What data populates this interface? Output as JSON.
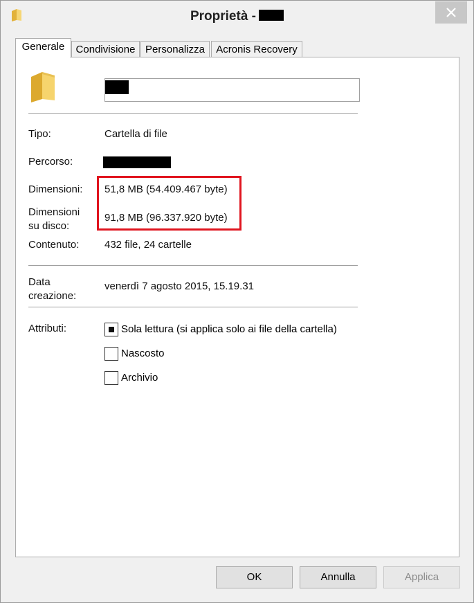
{
  "window": {
    "title": "Proprietà -"
  },
  "tabs": [
    {
      "label": "Generale"
    },
    {
      "label": "Condivisione"
    },
    {
      "label": "Personalizza"
    },
    {
      "label": "Acronis Recovery"
    }
  ],
  "general": {
    "type_label": "Tipo:",
    "type_value": "Cartella di file",
    "path_label": "Percorso:",
    "size_label": "Dimensioni:",
    "size_value": "51,8 MB (54.409.467 byte)",
    "disk_size_label_line1": "Dimensioni",
    "disk_size_label_line2": "su disco:",
    "disk_size_value": "91,8 MB (96.337.920 byte)",
    "contents_label": "Contenuto:",
    "contents_value": "432 file, 24 cartelle",
    "created_label_line1": "Data",
    "created_label_line2": "creazione:",
    "created_value": "venerdì 7 agosto 2015, 15.19.31",
    "attributes_label": "Attributi:",
    "attributes": [
      {
        "label": "Sola lettura (si applica solo ai file della cartella)",
        "state": "indeterminate"
      },
      {
        "label": "Nascosto",
        "state": "unchecked"
      },
      {
        "label": "Archivio",
        "state": "unchecked"
      }
    ]
  },
  "buttons": {
    "ok": "OK",
    "cancel": "Annulla",
    "apply": "Applica"
  },
  "colors": {
    "highlight": "#e0141e",
    "folder": "#f3cd5c"
  },
  "icons": {
    "title_icon": "folder-icon",
    "close": "close-icon",
    "main_icon": "folder-icon"
  }
}
